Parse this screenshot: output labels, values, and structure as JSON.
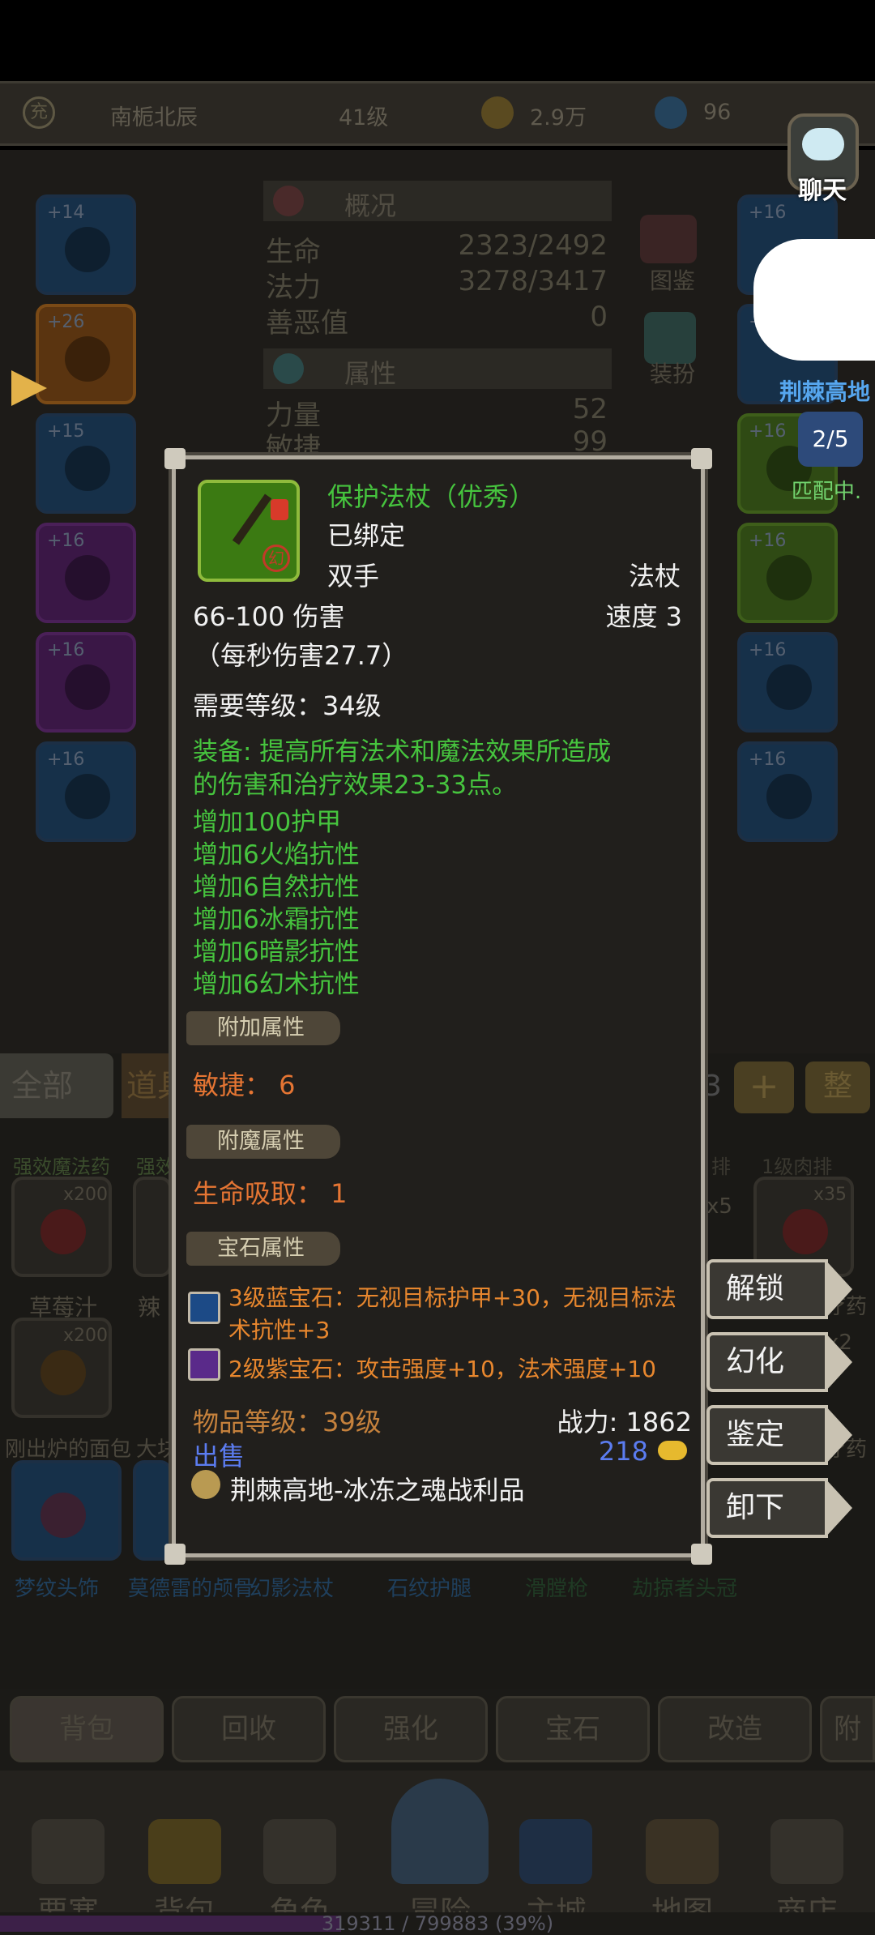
{
  "topbar": {
    "name": "南栀北辰",
    "level": "41级",
    "gold": "2.9万",
    "gems": "96",
    "badge": "充"
  },
  "chat": {
    "label": "聊天"
  },
  "pvp": {
    "region": "荆棘高地",
    "count": "2/5",
    "status": "匹配中."
  },
  "background": {
    "overview_title": "概况",
    "stats": [
      {
        "k": "生命",
        "v": "2323/2492"
      },
      {
        "k": "法力",
        "v": "3278/3417"
      },
      {
        "k": "善恶值",
        "v": "0"
      }
    ],
    "attr_title": "属性",
    "attrs": [
      {
        "k": "力量",
        "v": "52"
      },
      {
        "k": "敏捷",
        "v": "99"
      }
    ],
    "side_labels": [
      "图鉴",
      "装扮"
    ],
    "left_slots": [
      "+14",
      "+26",
      "+15",
      "+16",
      "+16",
      "+16"
    ],
    "right_slots": [
      "+16",
      "+16",
      "+16",
      "+16",
      "+16",
      "+16"
    ]
  },
  "inventory": {
    "filter_all": "全部",
    "filter_items": "道具",
    "count_hint": "3",
    "plus": "+",
    "sort": "整",
    "row_labels": [
      "强效魔法药",
      "强效",
      "排",
      "1级肉排"
    ],
    "items": [
      {
        "name": "草莓汁",
        "count": "x200"
      },
      {
        "name": "辣",
        "count": ""
      },
      {
        "name": "刚出炉的面包",
        "count": "x200"
      },
      {
        "name": "大块",
        "count": ""
      }
    ],
    "right_items": [
      {
        "count": "x5"
      },
      {
        "count": "x35"
      },
      {
        "count": "x2"
      }
    ],
    "right_labels": [
      "疗药",
      "疗药"
    ],
    "bottom_labels": [
      "梦纹头饰",
      "莫德雷的颅骨",
      "幻影法杖",
      "石纹护腿",
      "滑膛枪",
      "劫掠者头冠"
    ]
  },
  "tabs": [
    "背包",
    "回收",
    "强化",
    "宝石",
    "改造",
    "附"
  ],
  "nav": [
    "要塞",
    "背包",
    "角色",
    "冒险",
    "主城",
    "地图",
    "商店"
  ],
  "xp": {
    "text": "319311 / 799883 (39%)",
    "fraction": 0.39
  },
  "tooltip": {
    "name": "保护法杖（优秀）",
    "bound": "已绑定",
    "hand": "双手",
    "type": "法杖",
    "damage": "66-100 伤害",
    "speed": "速度 3",
    "dps": "（每秒伤害27.7）",
    "req_level": "需要等级：34级",
    "equip_line1": "装备: 提高所有法术和魔法效果所造成",
    "equip_line2": "的伤害和治疗效果23-33点。",
    "bonuses": [
      "增加100护甲",
      "增加6火焰抗性",
      "增加6自然抗性",
      "增加6冰霜抗性",
      "增加6暗影抗性",
      "增加6幻术抗性"
    ],
    "extra_title": "附加属性",
    "extra": "敏捷：  6",
    "enchant_title": "附魔属性",
    "enchant": "生命吸取：  1",
    "gem_title": "宝石属性",
    "gem1_line1": "3级蓝宝石：无视目标护甲+30，无视目标法",
    "gem1_line2": "术抗性+3",
    "gem2": "2级紫宝石：攻击强度+10，法术强度+10",
    "item_level": "物品等级：39级",
    "power": "战力: 1862",
    "sell_label": "出售",
    "sell_price": "218",
    "source": "荆棘高地-冰冻之魂战利品",
    "icon_mark": "幻"
  },
  "actions": [
    "解锁",
    "幻化",
    "鉴定",
    "卸下"
  ],
  "colors": {
    "quality_green": "#46c43e",
    "accent_orange": "#e57533",
    "sell_blue": "#5b7cf0",
    "gem_orange": "#e8872e"
  }
}
